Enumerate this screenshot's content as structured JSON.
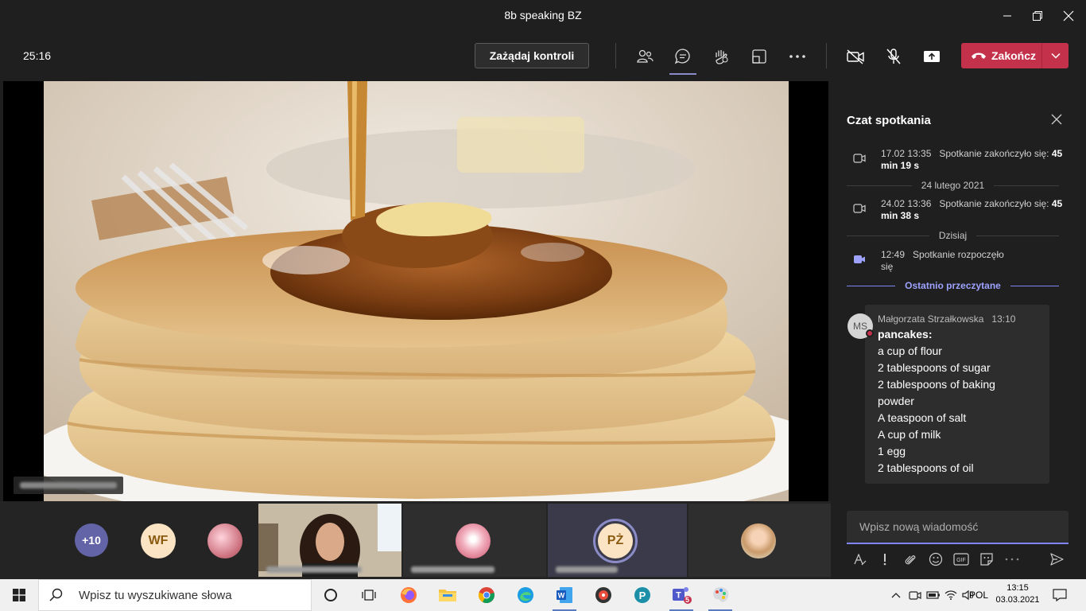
{
  "window": {
    "title": "8b speaking BZ"
  },
  "toolbar": {
    "timer": "25:16",
    "request_control_label": "Zażądaj kontroli",
    "end_call_label": "Zakończ",
    "icons": [
      "participants-icon",
      "chat-icon",
      "raise-hand-icon",
      "share-tray-icon",
      "more-icon",
      "camera-off-icon",
      "mic-off-icon",
      "share-screen-icon"
    ]
  },
  "stage": {
    "content": "shared video of a pancake stack with syrup",
    "presenter_name_blurred": true
  },
  "participants": {
    "overflow_count": "+10",
    "initials_1": "WF",
    "initials_2": "PŻ"
  },
  "chat": {
    "title": "Czat spotkania",
    "events": [
      {
        "time": "17.02 13:35",
        "text": "Spotkanie zakończyło się:",
        "duration": "45 min 19 s"
      },
      {
        "time": "24.02 13:36",
        "text": "Spotkanie zakończyło się:",
        "duration": "45 min 38 s"
      },
      {
        "time": "12:49",
        "text": "Spotkanie rozpoczęło się"
      }
    ],
    "dividers": {
      "d1": "24 lutego 2021",
      "d2": "Dzisiaj",
      "last_read": "Ostatnio przeczytane"
    },
    "message": {
      "avatar": "MS",
      "author": "Małgorzata Strzałkowska",
      "time": "13:10",
      "lines": [
        "pancakes:",
        "a cup of flour",
        "2 tablespoons of sugar",
        "2 tablespoons of baking",
        "powder",
        "A teaspoon of salt",
        "A cup of milk",
        "1 egg",
        "2 tablespoons of oil"
      ]
    },
    "compose_placeholder": "Wpisz nową wiadomość"
  },
  "taskbar": {
    "search_placeholder": "Wpisz tu wyszukiwane słowa",
    "teams_badge": "5",
    "language": "POL",
    "time": "13:15",
    "date": "03.03.2021"
  },
  "colors": {
    "accent": "#7f85f5",
    "end_call": "#c4314b",
    "avatar_purple": "#6264a7",
    "avatar_wf": "#fbe4c4"
  }
}
